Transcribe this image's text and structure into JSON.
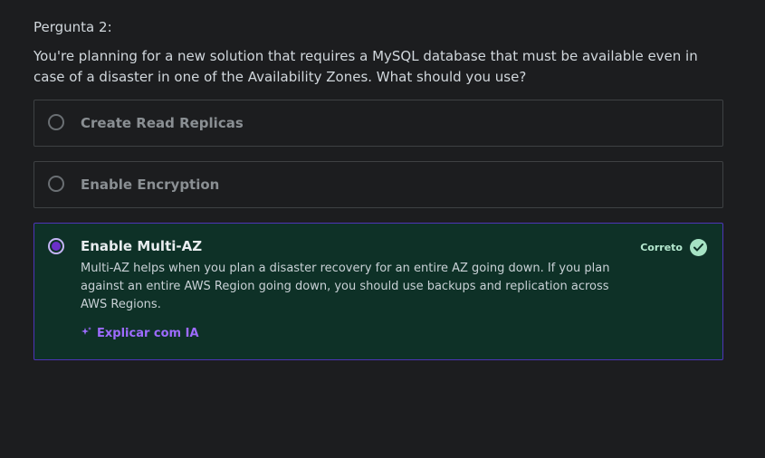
{
  "question": {
    "label": "Pergunta 2:",
    "text": "You're planning for a new solution that requires a MySQL database that must be available even in case of a disaster in one of the Availability Zones. What should you use?"
  },
  "options": [
    {
      "label": "Create Read Replicas",
      "selected": false
    },
    {
      "label": "Enable Encryption",
      "selected": false
    },
    {
      "label": "Enable Multi-AZ",
      "selected": true,
      "result": "Correto",
      "explanation": "Multi-AZ helps when you plan a disaster recovery for an entire AZ going down. If you plan against an entire AWS Region going down, you should use backups and replication across AWS Regions.",
      "ai_link": "Explicar com IA"
    }
  ],
  "colors": {
    "correct_bg": "#0e3127",
    "accent": "#6b2fc9",
    "link": "#9d6bff",
    "check": "#a6e3c4"
  },
  "icons": {
    "sparkle": "sparkle-icon",
    "check": "check-circle-icon"
  }
}
